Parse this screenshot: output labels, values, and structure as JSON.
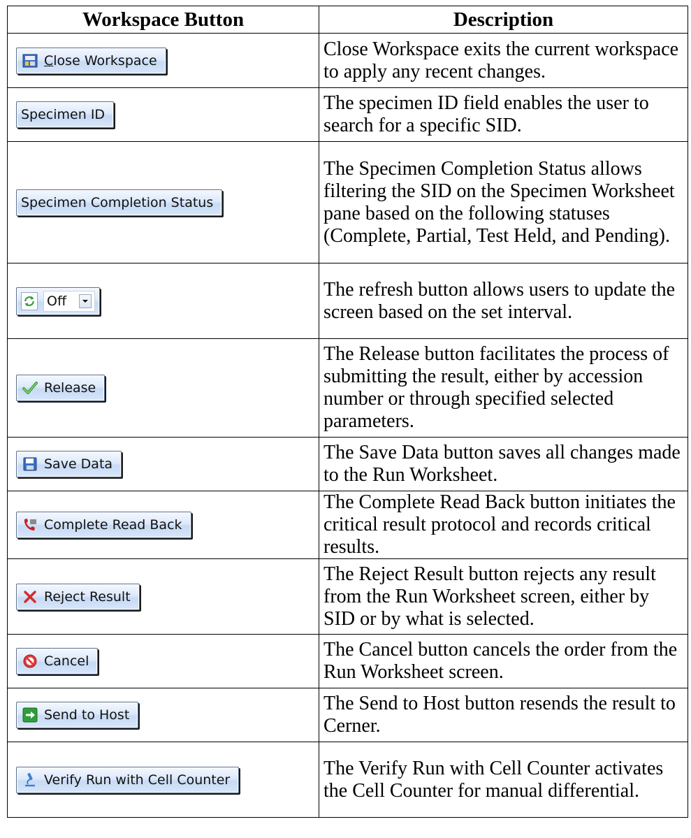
{
  "header": {
    "col1": "Workspace Button",
    "col2": "Description"
  },
  "rows": [
    {
      "button_label": "Close Workspace",
      "button_label_underlined": "C",
      "button_label_rest": "lose Workspace",
      "icon": "close-workspace-icon",
      "description": "Close Workspace exits the current workspace to apply any recent changes."
    },
    {
      "button_label": "Specimen ID",
      "icon": "",
      "description": "The specimen ID field enables the user to search for a specific SID."
    },
    {
      "button_label": "Specimen Completion Status",
      "icon": "",
      "description": "The Specimen Completion Status allows filtering the SID on the Specimen Worksheet pane based on the following statuses (Complete, Partial, Test Held, and Pending)."
    },
    {
      "button_label": "Off",
      "icon": "refresh-icon",
      "description": "The refresh button allows users to update the screen based on the set interval."
    },
    {
      "button_label": "Release",
      "icon": "checkmark-icon",
      "description": "The Release button facilitates the process of submitting the result, either by accession number or through specified selected parameters."
    },
    {
      "button_label": "Save Data",
      "icon": "floppy-disk-icon",
      "description": "The Save Data button saves all changes made to the Run Worksheet."
    },
    {
      "button_label": "Complete Read Back",
      "icon": "phone-icon",
      "description": "The Complete Read Back button initiates the critical result protocol and records critical results."
    },
    {
      "button_label": "Reject Result",
      "icon": "red-x-icon",
      "description": "The Reject Result button rejects any result from the Run Worksheet screen, either by SID or by what is selected."
    },
    {
      "button_label": "Cancel",
      "icon": "prohibited-icon",
      "description": "The Cancel button cancels the order from the Run Worksheet screen."
    },
    {
      "button_label": "Send to Host",
      "icon": "green-arrow-icon",
      "description": "The Send to Host button resends the result to Cerner."
    },
    {
      "button_label": "Verify Run with Cell Counter",
      "icon": "microscope-icon",
      "description": "The Verify Run with Cell Counter activates the Cell Counter for manual differential."
    }
  ],
  "colors": {
    "button_gradient_top": "#f3f8ff",
    "button_gradient_bottom": "#c7daf4",
    "button_border": "#5a6f8c",
    "reject_red": "#d42a2a",
    "send_green": "#2e9e3a",
    "phone_red": "#c8201e"
  }
}
